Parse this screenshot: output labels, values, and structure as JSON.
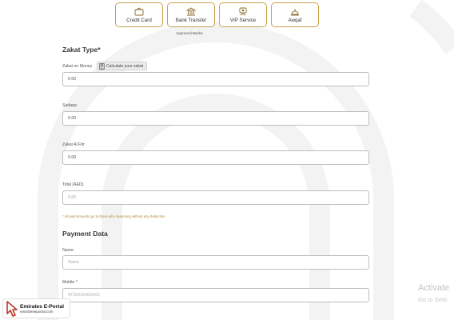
{
  "payment_methods": [
    {
      "label": "Credit Card",
      "icon": "credit-card-icon"
    },
    {
      "label": "Bank Transfer",
      "icon": "bank-icon"
    },
    {
      "label": "VIP Service",
      "icon": "vip-icon"
    },
    {
      "label": "Awqaf",
      "icon": "awqaf-dome-icon"
    }
  ],
  "approved_banks_label": "Approved Banks",
  "zakat": {
    "title": "Zakat Type*",
    "money_label": "Zakat on Money",
    "calc_label": "Calculate your zakat",
    "money_value": "0.00",
    "sadaqa_label": "Sadaqa",
    "sadaqa_value": "0.00",
    "fitr_label": "Zakat Al Fitr",
    "fitr_value": "0.00",
    "total_label": "Total (AED)",
    "total_value": "0.00",
    "note": "* All paid amounts go to those who deserving without any deduction"
  },
  "payment_data": {
    "title": "Payment Data",
    "name_label": "Name",
    "name_placeholder": "Name",
    "mobile_label": "Mobile *",
    "mobile_placeholder": "971XXXXXXXXX"
  },
  "watermark": {
    "title": "Activate",
    "subtitle": "Go to Setti"
  },
  "logo": {
    "name": "Emirates E-Portal",
    "url": "emirateseportal.com"
  },
  "colors": {
    "accent": "#c9a24a",
    "note": "#b08a3a",
    "border": "#bdbdbd"
  }
}
